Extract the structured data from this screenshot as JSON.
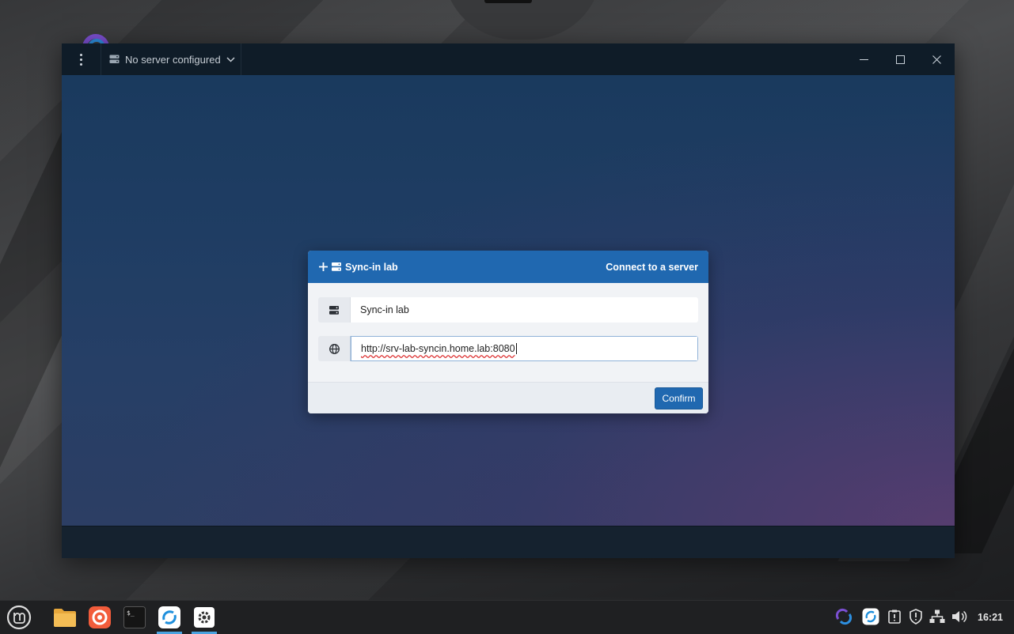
{
  "window": {
    "server_select_label": "No server configured"
  },
  "dialog": {
    "title": "Sync-in lab",
    "header_action": "Connect to a server",
    "name_value": "Sync-in lab",
    "url_value": "http://srv-lab-syncin.home.lab:8080",
    "confirm_label": "Confirm"
  },
  "taskbar": {
    "apps": [
      "menu-icon",
      "files-icon",
      "firefox-icon",
      "terminal-icon",
      "sync-in-icon",
      "settings-icon"
    ],
    "clock": "16:21"
  },
  "colors": {
    "accent": "#2068b0",
    "titlebar": "#0f1c28",
    "taskbar": "#1f2022"
  }
}
